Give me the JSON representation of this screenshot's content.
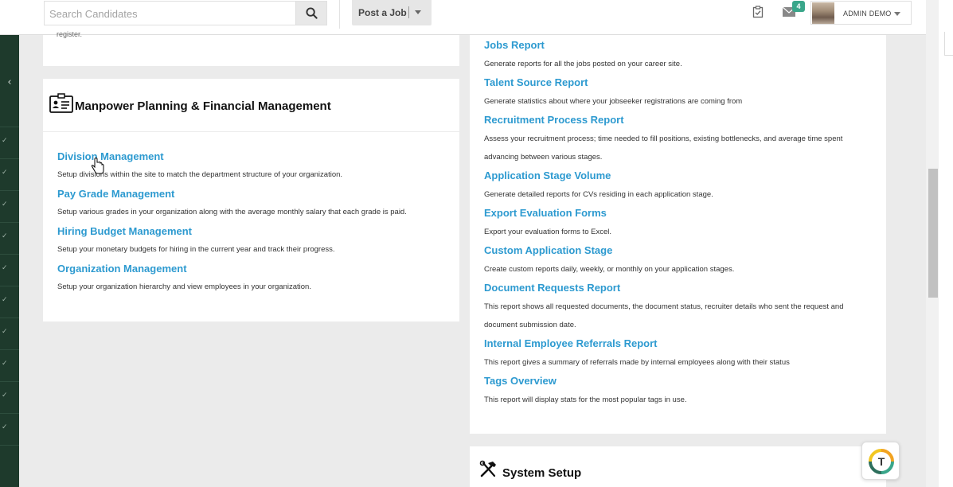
{
  "search": {
    "placeholder": "Search Candidates"
  },
  "post_job": {
    "label": "Post a Job"
  },
  "notifications": {
    "mail_count": "4"
  },
  "user": {
    "name": "ADMIN DEMO"
  },
  "top_left_card": {
    "text": "register."
  },
  "manpower": {
    "title": "Manpower Planning & Financial Management",
    "items": [
      {
        "title": "Division Management",
        "desc": "Setup divisions within the site to match the department structure of your organization."
      },
      {
        "title": "Pay Grade Management",
        "desc": "Setup various grades in your organization along with the average monthly salary that each grade is paid."
      },
      {
        "title": "Hiring Budget Management",
        "desc": "Setup your monetary budgets for hiring in the current year and track their progress."
      },
      {
        "title": "Organization Management",
        "desc": "Setup your organization hierarchy and view employees in your organization."
      }
    ]
  },
  "reports": {
    "items": [
      {
        "title": "Jobs Report",
        "desc": "Generate reports for all the jobs posted on your career site."
      },
      {
        "title": "Talent Source Report",
        "desc": "Generate statistics about where your jobseeker registrations are coming from"
      },
      {
        "title": "Recruitment Process Report",
        "desc": "Assess your recruitment process; time needed to fill positions, existing bottlenecks, and average time spent",
        "desc2": "advancing between various stages."
      },
      {
        "title": "Application Stage Volume",
        "desc": "Generate detailed reports for CVs residing in each application stage."
      },
      {
        "title": "Export Evaluation Forms",
        "desc": "Export your evaluation forms to Excel."
      },
      {
        "title": "Custom Application Stage",
        "desc": "Create custom reports daily, weekly, or monthly on your application stages."
      },
      {
        "title": "Document Requests Report",
        "desc": "This report shows all requested documents, the document status, recruiter details who sent the request and",
        "desc2": "document submission date."
      },
      {
        "title": "Internal Employee Referrals Report",
        "desc": "This report gives a summary of referrals made by internal employees along with their status"
      },
      {
        "title": "Tags Overview",
        "desc": "This report will display stats for the most popular tags in use."
      }
    ]
  },
  "system_setup": {
    "title": "System Setup"
  },
  "help_widget": {
    "letter": "T"
  }
}
